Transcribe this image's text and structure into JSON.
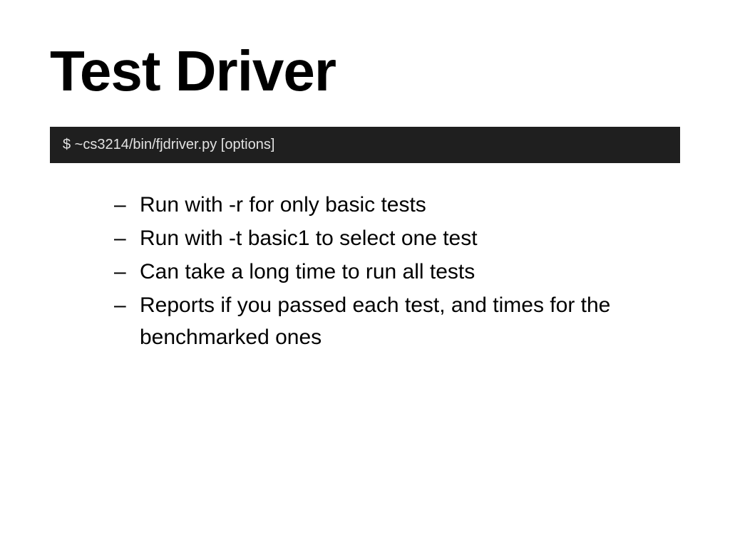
{
  "title": "Test Driver",
  "code": "$ ~cs3214/bin/fjdriver.py [options]",
  "bullets": [
    "Run with -r for only basic tests",
    "Run with -t basic1 to select one test",
    "Can take a long time to run all tests",
    "Reports if you passed each test, and times for the benchmarked ones"
  ]
}
